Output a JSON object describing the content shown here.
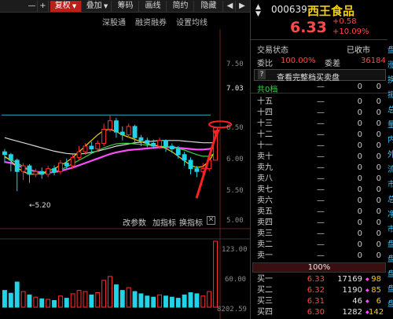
{
  "toolbar": {
    "minus": "—",
    "plus": "+",
    "fuquan": "复权",
    "diejia": "叠加",
    "chouma": "筹码",
    "huaxian": "画线",
    "jianyue": "简约",
    "yincang": "隐藏"
  },
  "chart": {
    "links": {
      "shenguitong": "深股通",
      "rongzirongquan": "融资融券",
      "shezhi": "设置均线"
    },
    "price_axis": [
      "7.50",
      "7.03",
      "6.50",
      "6.00",
      "5.50",
      "5.00"
    ],
    "current_price_tag": "7.03",
    "low_annotation": "5.20",
    "tools": {
      "gai_canshu": "改参数",
      "jia_zhibiao": "加指标",
      "huan_zhibiao": "换指标",
      "close": "✕"
    },
    "volume_axis": [
      "123.00",
      "60.00",
      "8202.59"
    ],
    "chart_data": {
      "type": "candlestick",
      "title": "",
      "xlabel": "",
      "ylabel": "",
      "ylim": [
        4.8,
        7.8
      ],
      "candles": [
        {
          "o": 5.9,
          "c": 5.85,
          "h": 5.95,
          "l": 5.7,
          "v": 30
        },
        {
          "o": 5.85,
          "c": 5.75,
          "h": 5.88,
          "l": 5.55,
          "v": 25
        },
        {
          "o": 5.75,
          "c": 5.55,
          "h": 5.78,
          "l": 5.2,
          "v": 45
        },
        {
          "o": 5.55,
          "c": 5.65,
          "h": 5.7,
          "l": 5.4,
          "v": 28
        },
        {
          "o": 5.65,
          "c": 5.5,
          "h": 5.68,
          "l": 5.35,
          "v": 22
        },
        {
          "o": 5.5,
          "c": 5.55,
          "h": 5.6,
          "l": 5.45,
          "v": 18
        },
        {
          "o": 5.55,
          "c": 5.5,
          "h": 5.62,
          "l": 5.42,
          "v": 15
        },
        {
          "o": 5.5,
          "c": 5.6,
          "h": 5.65,
          "l": 5.45,
          "v": 14
        },
        {
          "o": 5.6,
          "c": 5.55,
          "h": 5.66,
          "l": 5.48,
          "v": 12
        },
        {
          "o": 5.55,
          "c": 5.7,
          "h": 5.75,
          "l": 5.5,
          "v": 20
        },
        {
          "o": 5.7,
          "c": 5.65,
          "h": 5.78,
          "l": 5.6,
          "v": 16
        },
        {
          "o": 5.65,
          "c": 5.8,
          "h": 5.85,
          "l": 5.6,
          "v": 24
        },
        {
          "o": 5.8,
          "c": 5.9,
          "h": 6.0,
          "l": 5.75,
          "v": 30
        },
        {
          "o": 5.9,
          "c": 6.0,
          "h": 6.05,
          "l": 5.85,
          "v": 28
        },
        {
          "o": 6.0,
          "c": 5.95,
          "h": 6.08,
          "l": 5.88,
          "v": 22
        },
        {
          "o": 5.95,
          "c": 6.05,
          "h": 6.1,
          "l": 5.9,
          "v": 26
        },
        {
          "o": 6.05,
          "c": 6.3,
          "h": 6.4,
          "l": 6.0,
          "v": 48
        },
        {
          "o": 6.3,
          "c": 6.45,
          "h": 6.55,
          "l": 6.25,
          "v": 55
        },
        {
          "o": 6.45,
          "c": 6.25,
          "h": 6.5,
          "l": 6.15,
          "v": 40
        },
        {
          "o": 6.25,
          "c": 6.2,
          "h": 6.35,
          "l": 6.1,
          "v": 30
        },
        {
          "o": 6.2,
          "c": 6.35,
          "h": 6.4,
          "l": 6.15,
          "v": 35
        },
        {
          "o": 6.35,
          "c": 6.15,
          "h": 6.38,
          "l": 6.05,
          "v": 28
        },
        {
          "o": 6.15,
          "c": 6.1,
          "h": 6.2,
          "l": 6.0,
          "v": 24
        },
        {
          "o": 6.1,
          "c": 6.05,
          "h": 6.15,
          "l": 5.98,
          "v": 20
        },
        {
          "o": 6.05,
          "c": 6.0,
          "h": 6.12,
          "l": 5.95,
          "v": 18
        },
        {
          "o": 6.0,
          "c": 6.1,
          "h": 6.15,
          "l": 5.95,
          "v": 22
        },
        {
          "o": 6.1,
          "c": 6.0,
          "h": 6.12,
          "l": 5.9,
          "v": 20
        },
        {
          "o": 6.0,
          "c": 5.95,
          "h": 6.05,
          "l": 5.88,
          "v": 18
        },
        {
          "o": 5.95,
          "c": 5.85,
          "h": 6.0,
          "l": 5.78,
          "v": 16
        },
        {
          "o": 5.85,
          "c": 5.75,
          "h": 5.9,
          "l": 5.65,
          "v": 22
        },
        {
          "o": 5.75,
          "c": 5.6,
          "h": 5.8,
          "l": 5.5,
          "v": 26
        },
        {
          "o": 5.6,
          "c": 5.55,
          "h": 5.65,
          "l": 5.45,
          "v": 24
        },
        {
          "o": 5.55,
          "c": 5.6,
          "h": 5.7,
          "l": 5.5,
          "v": 20
        },
        {
          "o": 5.6,
          "c": 5.75,
          "h": 5.8,
          "l": 5.55,
          "v": 28
        },
        {
          "o": 5.75,
          "c": 6.33,
          "h": 6.33,
          "l": 5.75,
          "v": 118
        }
      ],
      "ma_series": [
        {
          "color": "#d8d8d8",
          "values": [
            6.15,
            6.12,
            6.09,
            6.06,
            6.03,
            6.0,
            5.97,
            5.94,
            5.91,
            5.89,
            5.87,
            5.86,
            5.86,
            5.87,
            5.89,
            5.91,
            5.94,
            5.97,
            6.0,
            6.02,
            6.04,
            6.06,
            6.07,
            6.08,
            6.09,
            6.1,
            6.1,
            6.1,
            6.1,
            6.09,
            6.08,
            6.07,
            6.06,
            6.06,
            6.06
          ]
        },
        {
          "color": "#ff4cff",
          "values": [
            5.72,
            5.7,
            5.66,
            5.62,
            5.58,
            5.55,
            5.53,
            5.53,
            5.54,
            5.56,
            5.59,
            5.62,
            5.66,
            5.7,
            5.74,
            5.78,
            5.82,
            5.86,
            5.89,
            5.91,
            5.93,
            5.94,
            5.95,
            5.96,
            5.97,
            5.98,
            5.98,
            5.98,
            5.97,
            5.96,
            5.95,
            5.94,
            5.94,
            5.95,
            5.98
          ]
        },
        {
          "color": "#3ecf4a",
          "values": [
            5.8,
            5.76,
            5.7,
            5.64,
            5.58,
            5.54,
            5.52,
            5.52,
            5.54,
            5.58,
            5.63,
            5.69,
            5.75,
            5.81,
            5.87,
            5.92,
            5.97,
            6.01,
            6.04,
            6.05,
            6.05,
            6.04,
            6.03,
            6.02,
            6.01,
            6.0,
            5.99,
            5.98,
            5.96,
            5.93,
            5.89,
            5.85,
            5.82,
            5.82,
            5.88
          ]
        },
        {
          "color": "#f0d000",
          "values": [
            5.82,
            5.74,
            5.62,
            5.55,
            5.5,
            5.5,
            5.52,
            5.56,
            5.6,
            5.66,
            5.72,
            5.8,
            5.9,
            6.0,
            6.1,
            6.2,
            6.28,
            6.3,
            6.26,
            6.2,
            6.16,
            6.12,
            6.08,
            6.04,
            6.02,
            6.0,
            5.96,
            5.9,
            5.82,
            5.74,
            5.66,
            5.62,
            5.64,
            5.74,
            5.92
          ]
        }
      ],
      "reference_line": 6.33
    }
  },
  "panel": {
    "code": "000639",
    "name": "西王食品",
    "price": "6.33",
    "change": "+0.58",
    "change_pct": "+10.09%",
    "status_label": "交易状态",
    "status_value": "已收市",
    "weibi_label": "委比",
    "weibi_value": "100.00%",
    "weicha_label": "委差",
    "weicha_value": "36184",
    "qmark": "?",
    "view_full": "查看完整档买卖盘",
    "total_label": "共0档",
    "sell_rows": [
      {
        "label": "十五",
        "px": "—",
        "vol": "0",
        "ext": "0"
      },
      {
        "label": "十四",
        "px": "—",
        "vol": "0",
        "ext": "0"
      },
      {
        "label": "十三",
        "px": "—",
        "vol": "0",
        "ext": "0"
      },
      {
        "label": "十二",
        "px": "—",
        "vol": "0",
        "ext": "0"
      },
      {
        "label": "十一",
        "px": "—",
        "vol": "0",
        "ext": "0"
      },
      {
        "label": "卖十",
        "px": "—",
        "vol": "0",
        "ext": "0"
      },
      {
        "label": "卖九",
        "px": "—",
        "vol": "0",
        "ext": "0"
      },
      {
        "label": "卖八",
        "px": "—",
        "vol": "0",
        "ext": "0"
      },
      {
        "label": "卖七",
        "px": "—",
        "vol": "0",
        "ext": "0"
      },
      {
        "label": "卖六",
        "px": "—",
        "vol": "0",
        "ext": "0"
      },
      {
        "label": "卖五",
        "px": "—",
        "vol": "0",
        "ext": "0"
      },
      {
        "label": "卖四",
        "px": "—",
        "vol": "0",
        "ext": "0"
      },
      {
        "label": "卖三",
        "px": "—",
        "vol": "0",
        "ext": "0"
      },
      {
        "label": "卖二",
        "px": "—",
        "vol": "0",
        "ext": "0"
      },
      {
        "label": "卖一",
        "px": "—",
        "vol": "0",
        "ext": "0"
      }
    ],
    "ratio_pct": "100%",
    "buy_rows": [
      {
        "label": "买一",
        "px": "6.33",
        "vol": "17169",
        "ext": "98"
      },
      {
        "label": "买二",
        "px": "6.32",
        "vol": "1190",
        "ext": "85"
      },
      {
        "label": "买三",
        "px": "6.31",
        "vol": "46",
        "ext": "6"
      },
      {
        "label": "买四",
        "px": "6.30",
        "vol": "1282",
        "ext": "142"
      }
    ],
    "right_strip": [
      "盘",
      "涨",
      "换",
      "振",
      "总",
      "量",
      "内",
      "外",
      "流",
      "市",
      "总",
      "净",
      "市",
      "盘",
      "盘",
      "盘",
      "盘",
      "盘"
    ]
  }
}
